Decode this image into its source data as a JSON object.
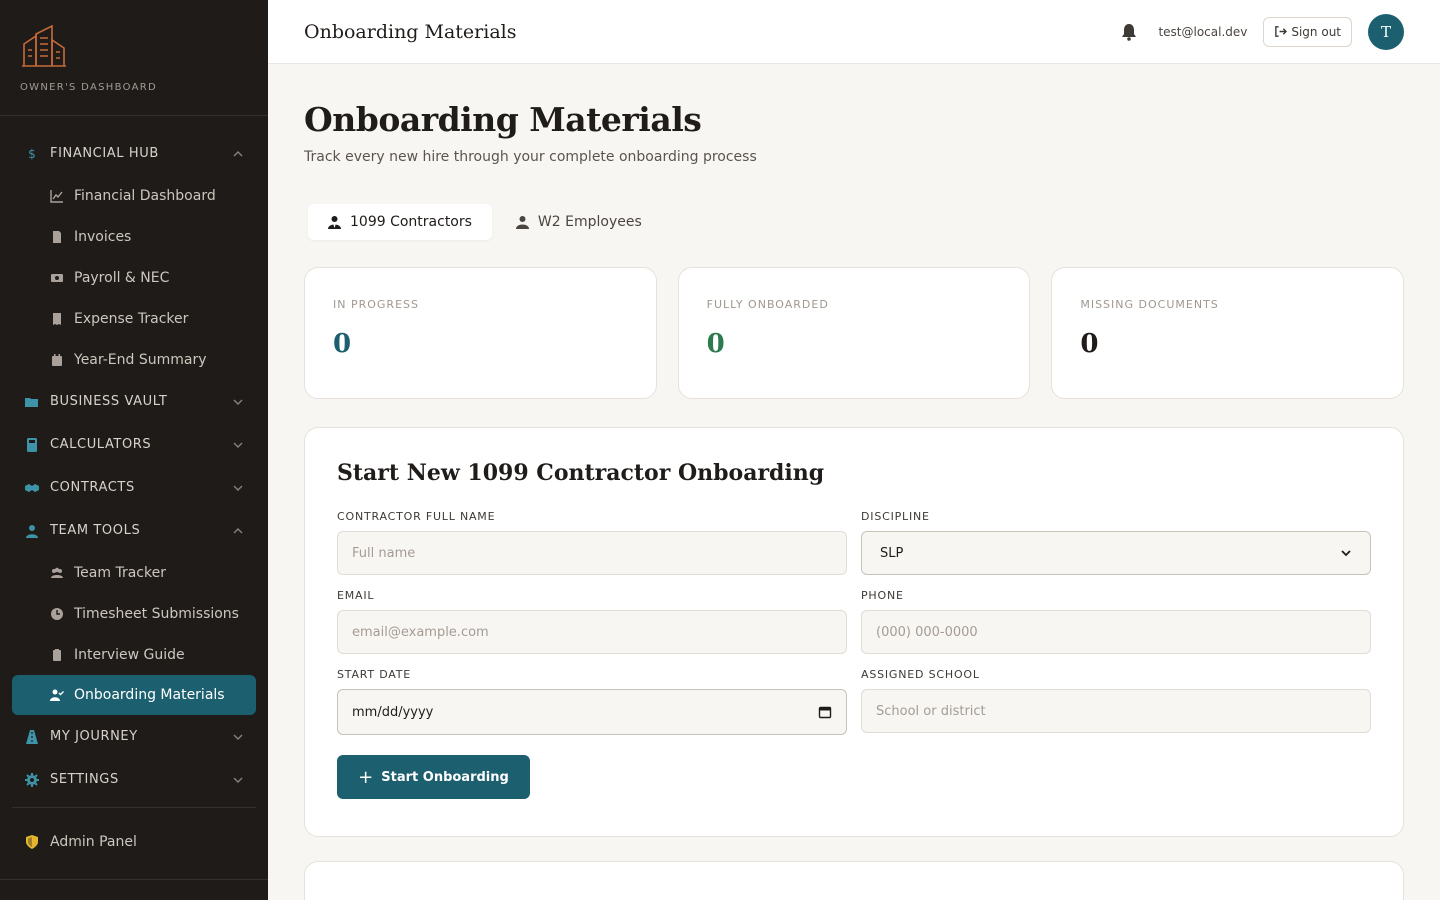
{
  "brand": {
    "label": "OWNER'S DASHBOARD"
  },
  "sidebar": {
    "financial_hub": {
      "label": "FINANCIAL HUB",
      "items": [
        "Financial Dashboard",
        "Invoices",
        "Payroll & NEC",
        "Expense Tracker",
        "Year-End Summary"
      ]
    },
    "business_vault": "BUSINESS VAULT",
    "calculators": "CALCULATORS",
    "contracts": "CONTRACTS",
    "team_tools": {
      "label": "TEAM TOOLS",
      "items": [
        "Team Tracker",
        "Timesheet Submissions",
        "Interview Guide",
        "Onboarding Materials"
      ]
    },
    "my_journey": "MY JOURNEY",
    "settings": "SETTINGS",
    "admin": "Admin Panel"
  },
  "topbar": {
    "title": "Onboarding Materials",
    "email": "test@local.dev",
    "signout": "Sign out",
    "avatar": "T"
  },
  "page": {
    "title": "Onboarding Materials",
    "subtitle": "Track every new hire through your complete onboarding process",
    "tabs": [
      "1099 Contractors",
      "W2 Employees"
    ]
  },
  "stats": [
    {
      "label": "IN PROGRESS",
      "value": "0",
      "color": "#1c5f6f"
    },
    {
      "label": "FULLY ONBOARDED",
      "value": "0",
      "color": "#2e7a4f"
    },
    {
      "label": "MISSING DOCUMENTS",
      "value": "0",
      "color": "#1f1c1a"
    }
  ],
  "form": {
    "title": "Start New 1099 Contractor Onboarding",
    "name_label": "CONTRACTOR FULL NAME",
    "name_placeholder": "Full name",
    "discipline_label": "DISCIPLINE",
    "discipline_value": "SLP",
    "email_label": "EMAIL",
    "email_placeholder": "email@example.com",
    "phone_label": "PHONE",
    "phone_placeholder": "(000) 000-0000",
    "start_label": "START DATE",
    "start_value": "mm/dd/yyyy",
    "school_label": "ASSIGNED SCHOOL",
    "school_placeholder": "School or district",
    "submit": "Start Onboarding"
  }
}
